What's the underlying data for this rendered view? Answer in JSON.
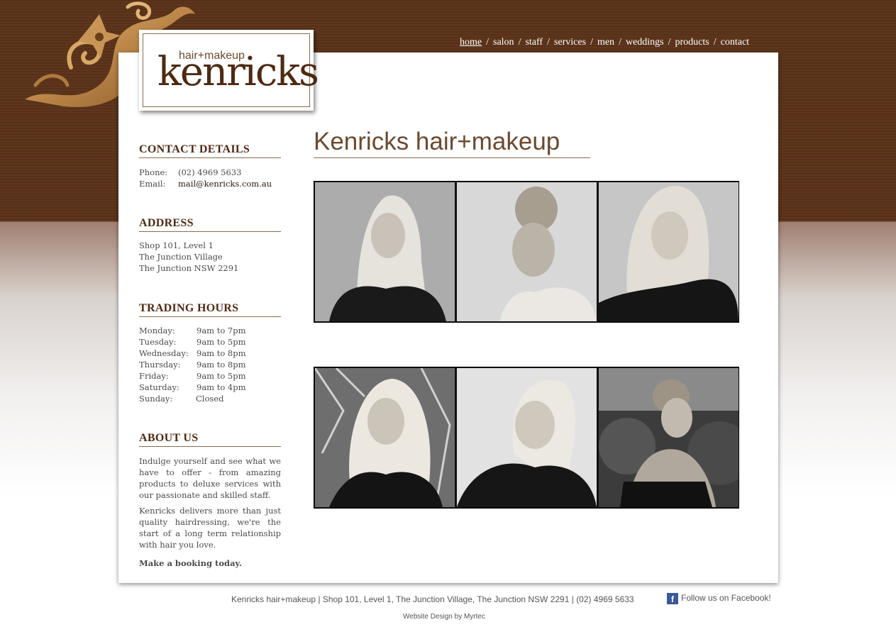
{
  "logo": {
    "small": "hair+makeup",
    "big": "kenricks"
  },
  "nav": [
    {
      "label": "home",
      "active": true
    },
    {
      "label": "salon"
    },
    {
      "label": "staff"
    },
    {
      "label": "services"
    },
    {
      "label": "men"
    },
    {
      "label": "weddings"
    },
    {
      "label": "products"
    },
    {
      "label": "contact"
    }
  ],
  "nav_sep": "/",
  "contact": {
    "heading": "CONTACT DETAILS",
    "phone_label": "Phone:",
    "phone": "(02) 4969 5633",
    "email_label": "Email:",
    "email": "mail@kenricks.com.au"
  },
  "address": {
    "heading": "ADDRESS",
    "lines": [
      "Shop 101, Level 1",
      "The Junction Village",
      "The Junction NSW 2291"
    ]
  },
  "hours": {
    "heading": "TRADING HOURS",
    "rows": [
      {
        "day": "Monday:",
        "time": "9am to 7pm"
      },
      {
        "day": "Tuesday:",
        "time": "9am to 5pm"
      },
      {
        "day": "Wednesday:",
        "time": "9am to 8pm"
      },
      {
        "day": "Thursday:",
        "time": "9am to 8pm"
      },
      {
        "day": "Friday:",
        "time": "9am to 5pm"
      },
      {
        "day": "Saturday:",
        "time": "9am to 4pm"
      },
      {
        "day": "Sunday:",
        "time": "Closed"
      }
    ]
  },
  "about": {
    "heading": "ABOUT US",
    "p1": "Indulge yourself and see what we have to offer - from amazing products to deluxe services with our passionate and skilled staff.",
    "p2": "Kenricks delivers more than just quality hairdressing, we're the start of a long term relationship with hair you love.",
    "p3": "Make a booking today."
  },
  "main_title": "Kenricks hair+makeup",
  "footer": {
    "text": "Kenricks hair+makeup | Shop 101, Level 1, The Junction Village, The Junction NSW 2291 | (02) 4969 5633",
    "facebook": "Follow us on Facebook!",
    "credit": "Website Design by Myrtec"
  },
  "colors": {
    "brown_dark": "#5a3219",
    "brown_text": "#4e2a12",
    "accent_line": "#8c6a4f",
    "facebook": "#3b5998"
  }
}
